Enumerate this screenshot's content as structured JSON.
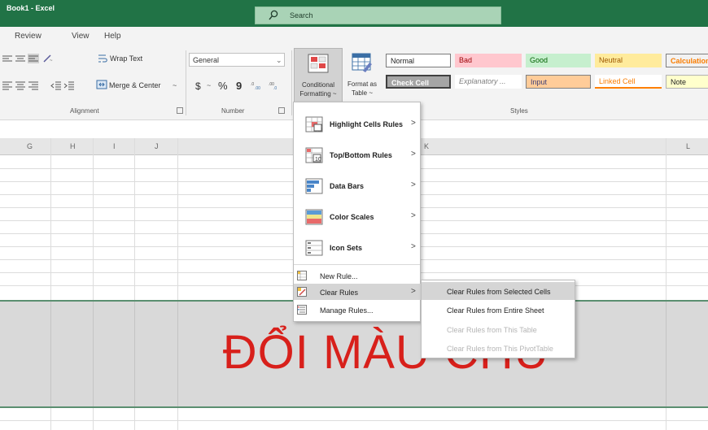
{
  "window": {
    "title": "Book1 - Excel",
    "accent": "#217346"
  },
  "search": {
    "label": "Search",
    "icon": "search-icon"
  },
  "menu": {
    "tabs": [
      "Review",
      "View",
      "Help"
    ]
  },
  "ribbon": {
    "alignment": {
      "wrap_text": "Wrap Text",
      "merge_center": "Merge & Center",
      "group_label": "Alignment"
    },
    "number": {
      "format": "General",
      "currency": "$",
      "percent": "%",
      "comma": "9",
      "group_label": "Number"
    },
    "conditional_formatting": {
      "line1": "Conditional",
      "line2": "Formatting ~"
    },
    "format_as_table": {
      "line1": "Format as",
      "line2": "Table ~"
    },
    "styles": {
      "group_label": "Styles",
      "cells": [
        {
          "label": "Normal",
          "bg": "#ffffff",
          "fg": "#222222"
        },
        {
          "label": "Bad",
          "bg": "#ffc7ce",
          "fg": "#9c0006"
        },
        {
          "label": "Good",
          "bg": "#c6efce",
          "fg": "#006100"
        },
        {
          "label": "Neutral",
          "bg": "#ffeb9c",
          "fg": "#9c5700"
        },
        {
          "label": "Calculation",
          "bg": "#f2f2f2",
          "fg": "#fa7d00"
        },
        {
          "label": "Check Cell",
          "bg": "#a5a5a5",
          "fg": "#ffffff"
        },
        {
          "label": "Explanatory ...",
          "bg": "#ffffff",
          "fg": "#7f7f7f"
        },
        {
          "label": "Input",
          "bg": "#ffcc99",
          "fg": "#3f3f76"
        },
        {
          "label": "Linked Cell",
          "bg": "#ffffff",
          "fg": "#fa7d00"
        },
        {
          "label": "Note",
          "bg": "#ffffcc",
          "fg": "#222222"
        }
      ]
    }
  },
  "columns": [
    "G",
    "H",
    "I",
    "J",
    "K",
    "L"
  ],
  "cell_text": "ĐỔI MÀU CHỮ",
  "cf_menu": {
    "items": [
      {
        "label": "Highlight Cells Rules",
        "icon": "highlight-cells-icon"
      },
      {
        "label": "Top/Bottom Rules",
        "icon": "top-bottom-icon"
      },
      {
        "label": "Data Bars",
        "icon": "data-bars-icon"
      },
      {
        "label": "Color Scales",
        "icon": "color-scales-icon"
      },
      {
        "label": "Icon Sets",
        "icon": "icon-sets-icon"
      }
    ],
    "new_rule": "New Rule...",
    "clear_rules": "Clear Rules",
    "manage_rules": "Manage Rules..."
  },
  "clear_submenu": {
    "items": [
      {
        "label": "Clear Rules from Selected Cells",
        "enabled": true
      },
      {
        "label": "Clear Rules from Entire Sheet",
        "enabled": true
      },
      {
        "label": "Clear Rules from This Table",
        "enabled": false
      },
      {
        "label": "Clear Rules from This PivotTable",
        "enabled": false
      }
    ]
  }
}
